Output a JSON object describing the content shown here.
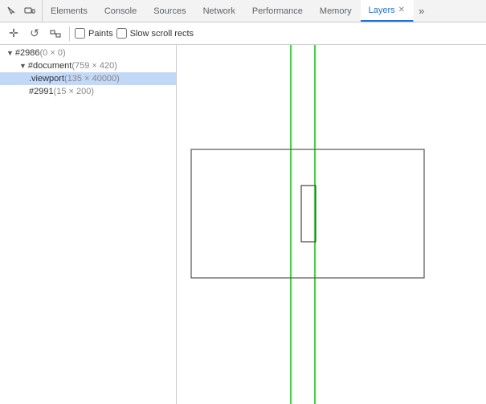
{
  "tabs": [
    {
      "label": "Elements",
      "active": false
    },
    {
      "label": "Console",
      "active": false
    },
    {
      "label": "Sources",
      "active": false
    },
    {
      "label": "Network",
      "active": false
    },
    {
      "label": "Performance",
      "active": false
    },
    {
      "label": "Memory",
      "active": false
    },
    {
      "label": "Layers",
      "active": true,
      "closeable": true
    }
  ],
  "toolbar": {
    "paints_label": "Paints",
    "slow_scroll_label": "Slow scroll rects"
  },
  "tree": {
    "root": {
      "id": "#2986",
      "size": "(0 × 0)",
      "children": [
        {
          "id": "#document",
          "size": "(759 × 420)",
          "children": [
            {
              "id": ".viewport",
              "size": "(135 × 40000)",
              "selected": true
            },
            {
              "id": "#2991",
              "size": "(15 × 200)"
            }
          ]
        }
      ]
    }
  }
}
